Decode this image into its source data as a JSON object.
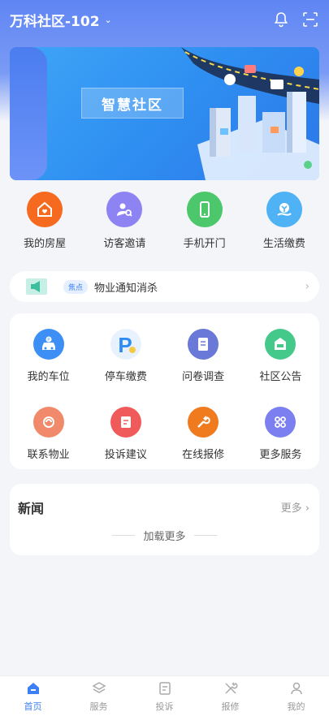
{
  "header": {
    "community": "万科社区-102",
    "icons": [
      "bell-icon",
      "scan-icon"
    ]
  },
  "banner": {
    "tag": "智慧社区"
  },
  "quick_actions": [
    {
      "label": "我的房屋",
      "icon": "house-icon",
      "color": "#f56a1f"
    },
    {
      "label": "访客邀请",
      "icon": "visitor-icon",
      "color": "#8d83f2"
    },
    {
      "label": "手机开门",
      "icon": "phone-door-icon",
      "color": "#4cc76b"
    },
    {
      "label": "生活缴费",
      "icon": "payment-icon",
      "color": "#4fb2f5"
    }
  ],
  "notice": {
    "tag": "焦点",
    "text": "物业通知消杀"
  },
  "services": [
    {
      "label": "我的车位",
      "icon": "car-icon",
      "color": "#3d8ff5"
    },
    {
      "label": "停车缴费",
      "icon": "parking-icon",
      "color": "#2f8df1"
    },
    {
      "label": "问卷调查",
      "icon": "survey-icon",
      "color": "#6a78d8"
    },
    {
      "label": "社区公告",
      "icon": "announcement-icon",
      "color": "#45c98a"
    },
    {
      "label": "联系物业",
      "icon": "contact-icon",
      "color": "#f08a6a"
    },
    {
      "label": "投诉建议",
      "icon": "complaint-icon",
      "color": "#f05a5a"
    },
    {
      "label": "在线报修",
      "icon": "repair-icon",
      "color": "#f07a1e"
    },
    {
      "label": "更多服务",
      "icon": "more-icon",
      "color": "#7b7ff0"
    }
  ],
  "news": {
    "title": "新闻",
    "more": "更多",
    "load_more": "加载更多"
  },
  "tabbar": [
    {
      "label": "首页",
      "icon": "home-icon",
      "active": true
    },
    {
      "label": "服务",
      "icon": "layers-icon",
      "active": false
    },
    {
      "label": "投诉",
      "icon": "complaint-tab-icon",
      "active": false
    },
    {
      "label": "报修",
      "icon": "tools-icon",
      "active": false
    },
    {
      "label": "我的",
      "icon": "user-icon",
      "active": false
    }
  ],
  "colors": {
    "accent": "#3d7ff5",
    "header_gradient_top": "#5f85f3"
  }
}
